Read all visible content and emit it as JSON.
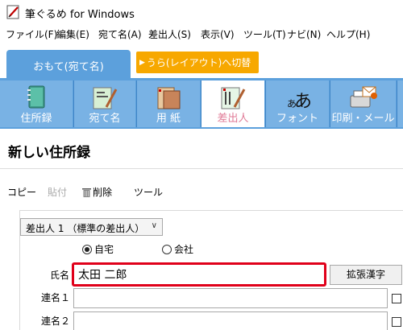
{
  "window": {
    "title": "筆ぐるめ for Windows"
  },
  "menu": [
    {
      "label": "ファイル(F)"
    },
    {
      "label": "編集(E)"
    },
    {
      "label": "宛て名(A)"
    },
    {
      "label": "差出人(S)"
    },
    {
      "label": "表示(V)"
    },
    {
      "label": "ツール(T)"
    },
    {
      "label": "ナビ(N)"
    },
    {
      "label": "ヘルプ(H)"
    }
  ],
  "tabs": {
    "front": "おもて(宛て名)",
    "back": "うら(レイアウト)へ切替"
  },
  "toolbar": [
    {
      "label": "住所録",
      "icon": "address-book-icon"
    },
    {
      "label": "宛て名",
      "icon": "address-card-icon"
    },
    {
      "label": "用 紙",
      "icon": "paper-icon"
    },
    {
      "label": "差出人",
      "icon": "sender-icon"
    },
    {
      "label": "フォント",
      "icon": "font-icon"
    },
    {
      "label": "印刷・メール",
      "icon": "print-mail-icon"
    }
  ],
  "colors": {
    "accent": "#5ca0dc",
    "tab_back": "#f7a800",
    "highlight": "#e0001a",
    "active_label": "#e07a96"
  },
  "page": {
    "title": "新しい住所録"
  },
  "edit_bar": {
    "copy": "コピー",
    "paste": "貼付",
    "delete": "削除",
    "tools": "ツール"
  },
  "form": {
    "sender_select": "差出人 1 （標準の差出人）",
    "radio_home": "自宅",
    "radio_company": "会社",
    "name_label": "氏名",
    "name_value": "太田 二郎",
    "ext_button": "拡張漢字",
    "joint1_label": "連名１",
    "joint1_value": "",
    "joint2_label": "連名２",
    "joint2_value": ""
  }
}
